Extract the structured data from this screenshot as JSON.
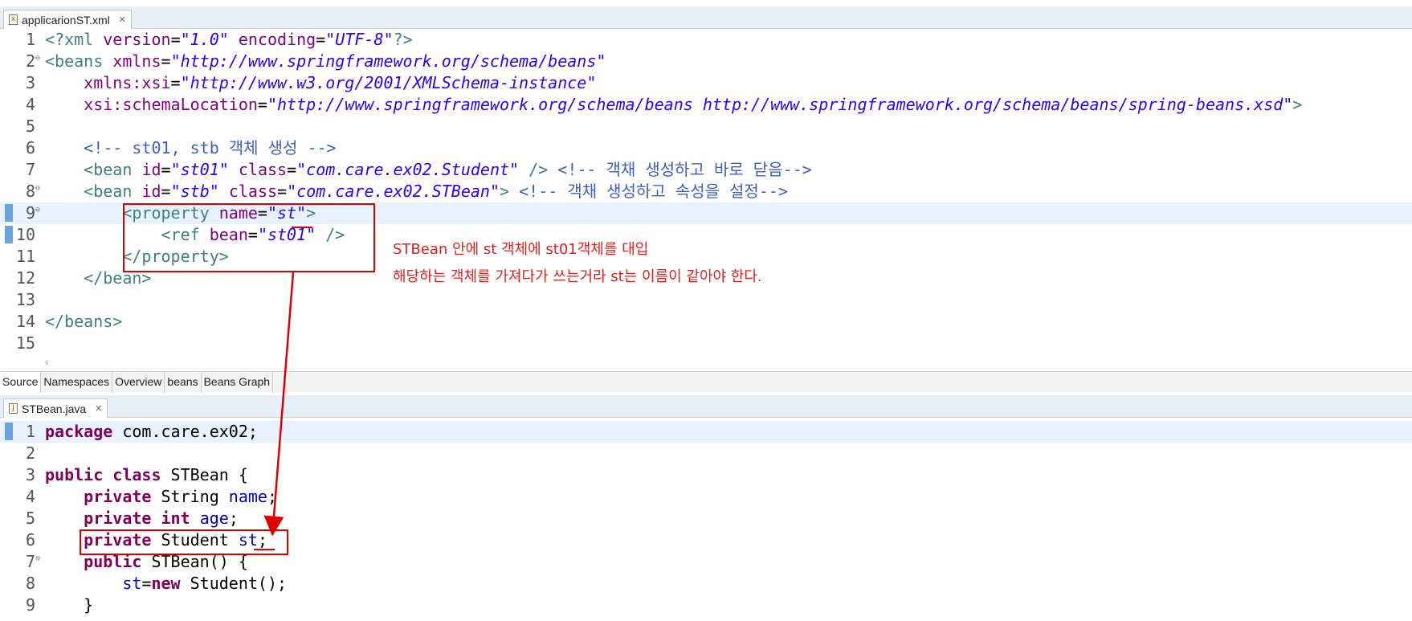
{
  "top_editor": {
    "tab_label": "applicarionST.xml",
    "lines": [
      {
        "n": "1",
        "html": "<span class=\"tag\">&lt;?xml</span> <span class=\"attr\">version</span>=<span class=\"str\">\"1.0\"</span> <span class=\"attr\">encoding</span>=<span class=\"str\">\"UTF-8\"</span><span class=\"tag\">?&gt;</span>"
      },
      {
        "n": "2",
        "fold": true,
        "html": "<span class=\"tag\">&lt;beans</span> <span class=\"attr\">xmlns</span>=<span class=\"str\">\"http://www.springframework.org/schema/beans\"</span>"
      },
      {
        "n": "3",
        "html": "    <span class=\"attr\">xmlns:xsi</span>=<span class=\"str\">\"http://www.w3.org/2001/XMLSchema-instance\"</span>"
      },
      {
        "n": "4",
        "html": "    <span class=\"attr\">xsi:schemaLocation</span>=<span class=\"str\">\"http://www.springframework.org/schema/beans http://www.springframework.org/schema/beans/spring-beans.xsd\"</span><span class=\"tag\">&gt;</span>"
      },
      {
        "n": "5",
        "html": ""
      },
      {
        "n": "6",
        "html": "    <span class=\"cmt\">&lt;!-- st01, stb 객체 생성 --&gt;</span>"
      },
      {
        "n": "7",
        "html": "    <span class=\"tag\">&lt;bean</span> <span class=\"attr\">id</span>=<span class=\"str\">\"st01\"</span> <span class=\"attr\">class</span>=<span class=\"str\">\"com.care.ex02.Student\"</span> <span class=\"tag\">/&gt;</span> <span class=\"cmt\">&lt;!-- 객채 생성하고 바로 닫음--&gt;</span>"
      },
      {
        "n": "8",
        "fold": true,
        "html": "    <span class=\"tag\">&lt;bean</span> <span class=\"attr\">id</span>=<span class=\"str\">\"stb\"</span> <span class=\"attr\">class</span>=<span class=\"str\">\"com.care.ex02.STBean\"</span><span class=\"tag\">&gt;</span> <span class=\"cmt\">&lt;!-- 객채 생성하고 속성을 설정--&gt;</span>"
      },
      {
        "n": "9",
        "fold": true,
        "hl": true,
        "mark": true,
        "html": "        <span class=\"tag\">&lt;property</span> <span class=\"attr\">name</span>=<span class=\"str\">\"st\"</span><span class=\"tag\">&gt;</span>"
      },
      {
        "n": "10",
        "mark": true,
        "html": "            <span class=\"tag\">&lt;ref</span> <span class=\"attr\">bean</span>=<span class=\"str\">\"st01\"</span> <span class=\"tag\">/&gt;</span>"
      },
      {
        "n": "11",
        "html": "        <span class=\"tag\">&lt;/property&gt;</span>"
      },
      {
        "n": "12",
        "html": "    <span class=\"tag\">&lt;/bean&gt;</span>"
      },
      {
        "n": "13",
        "html": ""
      },
      {
        "n": "14",
        "html": "<span class=\"tag\">&lt;/beans&gt;</span>"
      },
      {
        "n": "15",
        "html": ""
      }
    ],
    "bottom_tabs": [
      "Source",
      "Namespaces",
      "Overview",
      "beans",
      "Beans Graph"
    ]
  },
  "bottom_editor": {
    "tab_label": "STBean.java",
    "lines": [
      {
        "n": "1",
        "hl": true,
        "mark": true,
        "html": "<span class=\"kw\">package</span> com.care.ex02;"
      },
      {
        "n": "2",
        "html": ""
      },
      {
        "n": "3",
        "html": "<span class=\"kw\">public</span> <span class=\"kw\">class</span> STBean {"
      },
      {
        "n": "4",
        "html": "    <span class=\"kw\">private</span> String <span class=\"fld\">name</span>;"
      },
      {
        "n": "5",
        "html": "    <span class=\"kw\">private</span> <span class=\"kw\">int</span> <span class=\"fld\">age</span>;"
      },
      {
        "n": "6",
        "html": "    <span class=\"kw\">private</span> Student <span class=\"fld\">st</span>;"
      },
      {
        "n": "7",
        "fold": true,
        "html": "    <span class=\"kw\">public</span> STBean() {"
      },
      {
        "n": "8",
        "html": "        <span class=\"fld\">st</span>=<span class=\"kw\">new</span> Student();"
      },
      {
        "n": "9",
        "html": "    }"
      }
    ]
  },
  "annotations": {
    "note_line1": "STBean 안에 st 객체에 st01객체를 대입",
    "note_line2": "해당하는 객체를 가져다가 쓰는거라 st는 이름이 같아야 한다.",
    "color": "#e00000"
  }
}
